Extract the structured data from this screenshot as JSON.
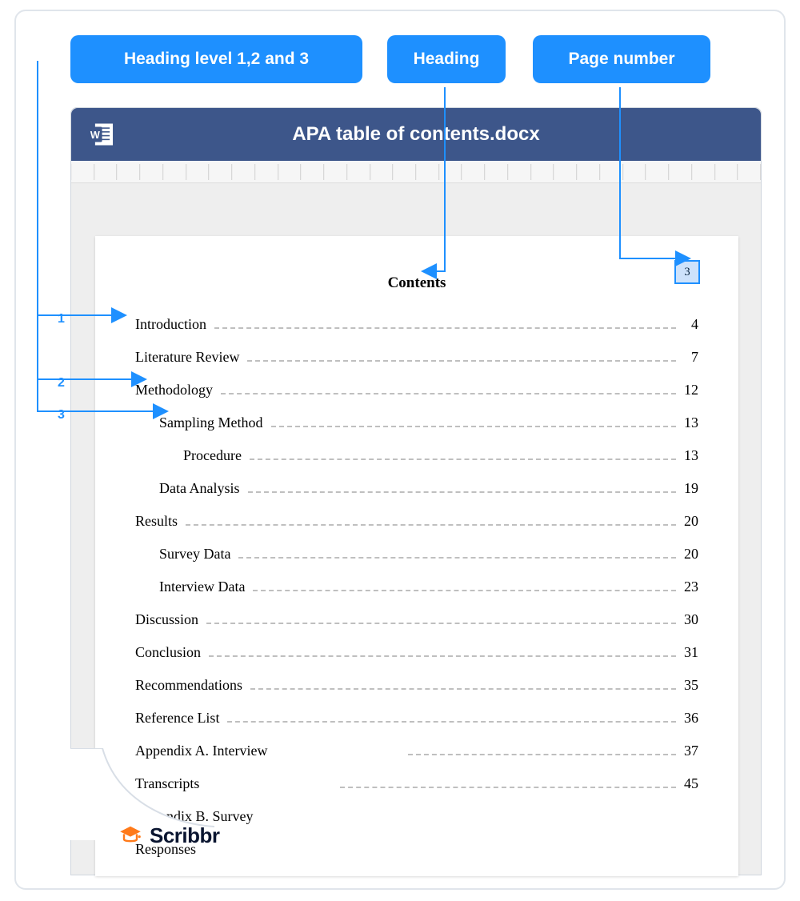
{
  "callouts": {
    "levels": "Heading level 1,2 and 3",
    "heading": "Heading",
    "page": "Page number"
  },
  "filename": "APA table of contents.docx",
  "page_number": "3",
  "contents_title": "Contents",
  "level_labels": {
    "l1": "1",
    "l2": "2",
    "l3": "3"
  },
  "toc": [
    {
      "label": "Introduction",
      "page": "4",
      "indent": 0,
      "leader": true
    },
    {
      "label": "Literature Review",
      "page": "7",
      "indent": 0,
      "leader": true
    },
    {
      "label": "Methodology",
      "page": "12",
      "indent": 0,
      "leader": true
    },
    {
      "label": "Sampling Method",
      "page": "13",
      "indent": 1,
      "leader": true
    },
    {
      "label": "Procedure",
      "page": "13",
      "indent": 2,
      "leader": true
    },
    {
      "label": "Data Analysis",
      "page": "19",
      "indent": 1,
      "leader": true
    },
    {
      "label": "Results",
      "page": "20",
      "indent": 0,
      "leader": true
    },
    {
      "label": "Survey Data",
      "page": "20",
      "indent": 1,
      "leader": true
    },
    {
      "label": "Interview Data",
      "page": "23",
      "indent": 1,
      "leader": true
    },
    {
      "label": "Discussion",
      "page": "30",
      "indent": 0,
      "leader": true
    },
    {
      "label": "Conclusion",
      "page": "31",
      "indent": 0,
      "leader": true
    },
    {
      "label": "Recommendations",
      "page": "35",
      "indent": 0,
      "leader": true
    },
    {
      "label": "Reference List",
      "page": "36",
      "indent": 0,
      "leader": true
    },
    {
      "label": "Appendix A. Interview",
      "page": "37",
      "indent": 0,
      "leader": true,
      "short": true
    },
    {
      "label": "Transcripts",
      "page": "45",
      "indent": 0,
      "leader": true,
      "short": true
    },
    {
      "label": "Appendix B. Survey",
      "page": "",
      "indent": 0,
      "leader": false
    },
    {
      "label": "Responses",
      "page": "",
      "indent": 0,
      "leader": false
    }
  ],
  "brand": "Scribbr"
}
